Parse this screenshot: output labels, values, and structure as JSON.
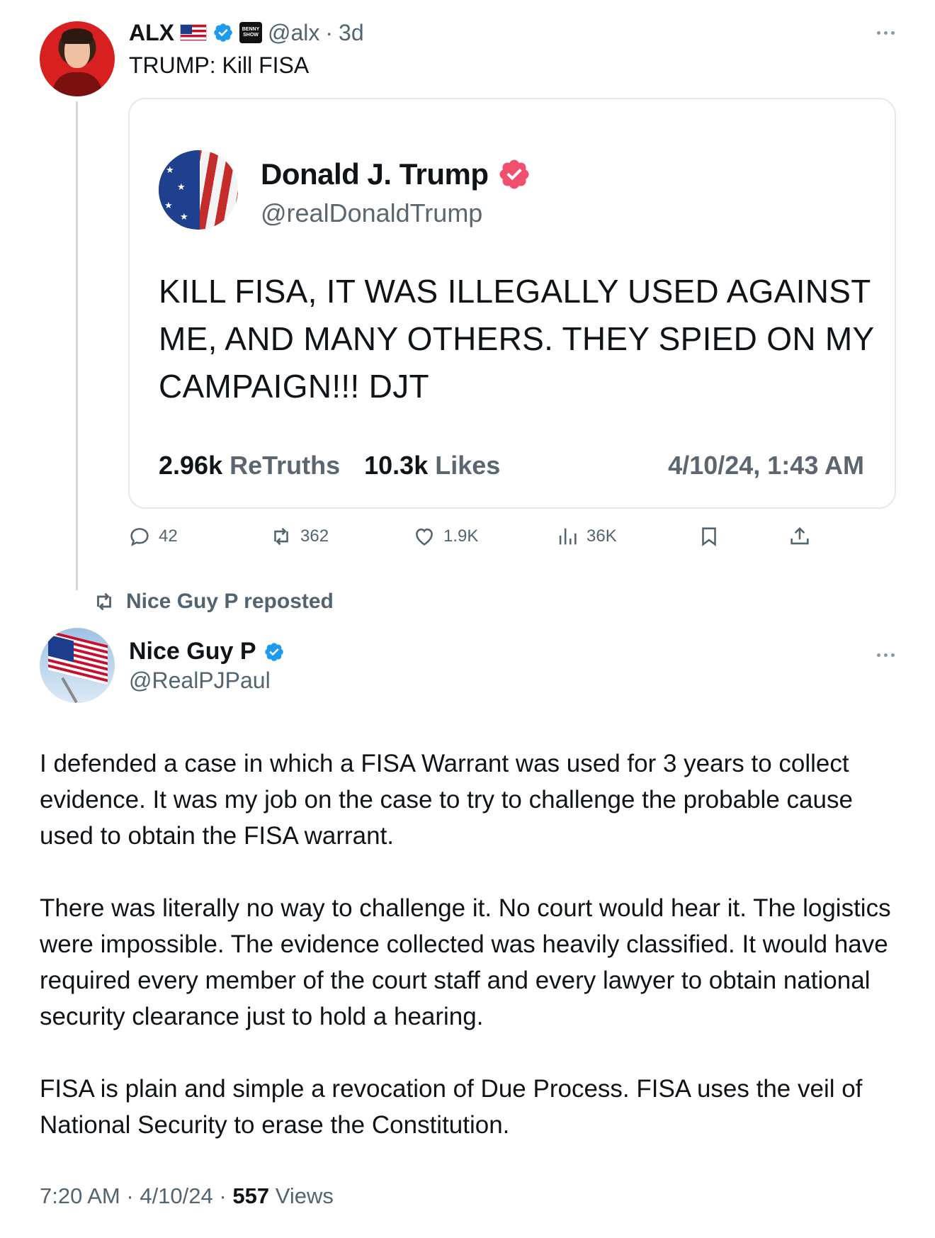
{
  "top_tweet": {
    "author_name": "ALX",
    "handle": "@alx",
    "separator": "·",
    "age": "3d",
    "affiliate_badge_text": "BENNY SHOW",
    "text": "TRUMP: Kill FISA"
  },
  "truth_card": {
    "author_name": "Donald J. Trump",
    "handle": "@realDonaldTrump",
    "text": "KILL FISA, IT WAS ILLEGALLY USED AGAINST ME, AND MANY OTHERS. THEY SPIED ON MY CAMPAIGN!!! DJT",
    "retruths_count": "2.96k",
    "retruths_label": "ReTruths",
    "likes_count": "10.3k",
    "likes_label": "Likes",
    "date": "4/10/24, 1:43 AM",
    "verified_color": "#f0506e"
  },
  "actions": {
    "replies": "42",
    "reposts": "362",
    "likes": "1.9K",
    "views": "36K"
  },
  "repost_notice": {
    "text": "Nice Guy P reposted"
  },
  "main_tweet": {
    "author_name": "Nice Guy P",
    "handle": "@RealPJPaul",
    "paragraphs": [
      "I defended a case in which a FISA Warrant was used for 3 years to collect evidence. It was my job on the case to try to challenge the probable cause used to obtain the FISA warrant.",
      "There was literally no way to challenge it. No court would hear it. The logistics were impossible. The evidence collected was heavily classified. It would have required every member of the court staff and every lawyer to obtain national security clearance just to hold a hearing.",
      "FISA is plain and simple a revocation of Due Process. FISA uses the veil of National Security to erase the Constitution."
    ],
    "time": "7:20 AM",
    "separator": "·",
    "date": "4/10/24",
    "views_count": "557",
    "views_label": "Views"
  },
  "colors": {
    "verified_blue": "#1d9bf0",
    "secondary_text": "#536471",
    "border": "#e6e9ec"
  },
  "icons": [
    "verified-icon",
    "us-flag-icon",
    "more-icon",
    "reply-icon",
    "retweet-icon",
    "like-icon",
    "views-icon",
    "bookmark-icon",
    "share-icon"
  ]
}
